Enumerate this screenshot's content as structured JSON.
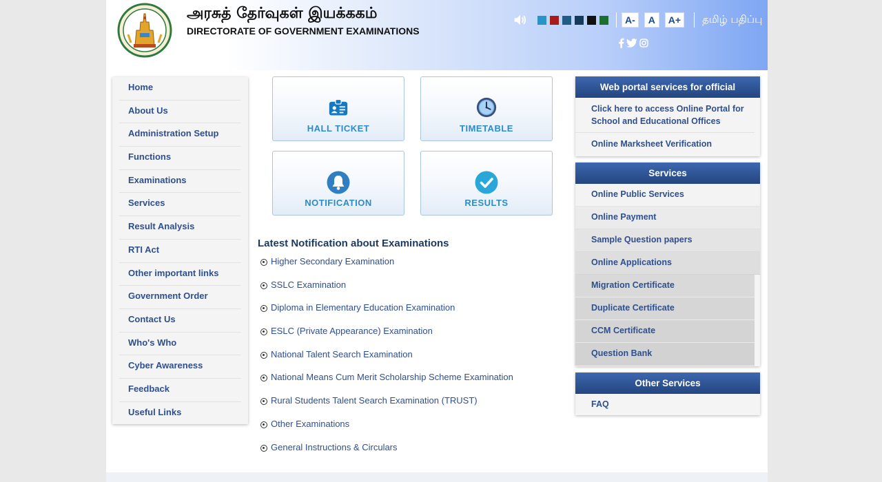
{
  "header": {
    "title_tamil": "அரசுத் தேர்வுகள் இயக்ககம்",
    "title_english": "DIRECTORATE OF GOVERNMENT EXAMINATIONS",
    "emblem_text": "வாய்மையே வெல்லும்",
    "font_buttons": [
      "A-",
      "A",
      "A+"
    ],
    "language_link": "தமிழ் பதிப்பு",
    "theme_colors": [
      "#2a94c9",
      "#a81b1b",
      "#1f5d87",
      "#143a5c",
      "#111111",
      "#1d6e2f"
    ],
    "social_icons": [
      "facebook-icon",
      "twitter-icon",
      "instagram-icon"
    ]
  },
  "left_menu": [
    "Home",
    "About Us",
    "Administration Setup",
    "Functions",
    "Examinations",
    "Services",
    "Result Analysis",
    "RTI Act",
    "Other important links",
    "Government Order",
    "Contact Us",
    "Who's Who",
    "Cyber Awareness",
    "Feedback",
    "Useful Links"
  ],
  "tiles": {
    "hall_ticket": "HALL TICKET",
    "timetable": "TIMETABLE",
    "notification": "NOTIFICATION",
    "results": "RESULTS"
  },
  "notifications": {
    "title": "Latest Notification about Examinations",
    "items": [
      "Higher Secondary Examination",
      "SSLC Examination",
      "Diploma in Elementary Education Examination",
      "ESLC (Private Appearance) Examination",
      "National Talent Search Examination",
      "National Means Cum Merit Scholarship Scheme Examination",
      "Rural Students Talent Search Examination (TRUST)",
      "Other Examinations",
      "General Instructions & Circulars"
    ]
  },
  "web_portal": {
    "title": "Web portal services for official",
    "items": [
      "Click here to access Online Portal for School and Educational Offices",
      "Online Marksheet Verification"
    ]
  },
  "services": {
    "title": "Services",
    "items": [
      "Online Public Services",
      "Online Payment",
      "Sample Question papers",
      "Online Applications",
      "Migration Certificate",
      "Duplicate Certificate",
      "CCM Certificate",
      "Question Bank"
    ]
  },
  "other_services": {
    "title": "Other Services",
    "items": [
      "FAQ"
    ]
  }
}
